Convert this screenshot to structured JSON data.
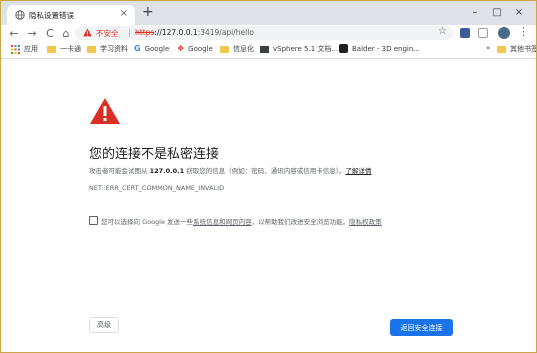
{
  "tab": {
    "title": "隐私设置错误",
    "favicon": "globe-icon",
    "close": "×"
  },
  "new_tab": "+",
  "window_controls": {
    "minimize": "–",
    "maximize": "□",
    "close": "×"
  },
  "nav": {
    "back": "←",
    "forward": "→",
    "reload": "C",
    "home": "⌂"
  },
  "omnibox": {
    "insecure_label": "不安全",
    "url_scheme": "https",
    "url_host": "://127.0.0.1",
    "url_port_path": ":3419/api/hello",
    "star": "☆"
  },
  "bookmarks": {
    "apps": "应用",
    "items": [
      "一卡通",
      "学习资料",
      "Google",
      "Google",
      "信息化",
      "vSphere 5.1 文档...",
      "Balder - 3D engin..."
    ],
    "overflow": "»",
    "other": "其他书签"
  },
  "interstitial": {
    "headline": "您的连接不是私密连接",
    "desc_prefix": "攻击者可能会试图从 ",
    "desc_host": "127.0.0.1",
    "desc_suffix": " 窃取您的信息（例如：密码、通讯内容或信用卡信息）。",
    "learn_more": "了解详情",
    "error_code": "NET::ERR_CERT_COMMON_NAME_INVALID",
    "optin_prefix": "您可以选择向 Google 发送一些",
    "optin_link1": "系统信息和网页内容",
    "optin_middle": "，以帮助我们改进安全浏览功能。",
    "optin_link2": "隐私权政策",
    "advanced_button": "高级",
    "back_button": "返回安全连接"
  },
  "colors": {
    "accent": "#1a73e8",
    "danger": "#d93025",
    "warning_icon": "#d93025"
  }
}
